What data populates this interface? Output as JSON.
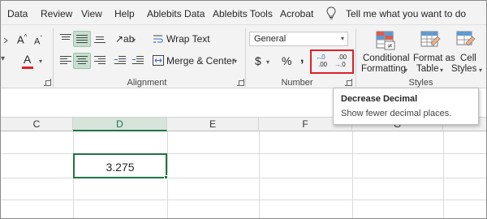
{
  "menu": {
    "items": [
      "Data",
      "Review",
      "View",
      "Help",
      "Ablebits Data",
      "Ablebits Tools",
      "Acrobat"
    ],
    "tell_me": "Tell me what you want to do"
  },
  "ribbon": {
    "font": {
      "grow_icon": "A^",
      "shrink_icon": "Aˇ",
      "font_color_letter": "A",
      "font_color": "#e0202b"
    },
    "alignment": {
      "wrap_text": "Wrap Text",
      "merge_center": "Merge & Center",
      "group_label": "Alignment"
    },
    "number": {
      "format_value": "General",
      "currency_symbol": "$",
      "percent_symbol": "%",
      "comma_symbol": ",",
      "increase_decimal_top": ".0",
      "increase_decimal_bottom": ".00",
      "decrease_decimal_top": ".00",
      "decrease_decimal_bottom": ".0",
      "group_label": "Number"
    },
    "styles": {
      "conditional_formatting_line1": "Conditional",
      "conditional_formatting_line2": "Formatting",
      "format_as_table_line1": "Format as",
      "format_as_table_line2": "Table",
      "cell_styles_line1": "Cell",
      "cell_styles_line2": "Styles",
      "group_label": "Styles"
    }
  },
  "tooltip": {
    "title": "Decrease Decimal",
    "description": "Show fewer decimal places."
  },
  "sheet": {
    "columns": [
      "C",
      "D",
      "E",
      "F",
      "G"
    ],
    "active_column": "D",
    "active_cell_value": "3.275"
  },
  "colors": {
    "accent_green": "#217346",
    "highlight_red": "#e0202b",
    "selected_button": "#c6dfd0"
  }
}
